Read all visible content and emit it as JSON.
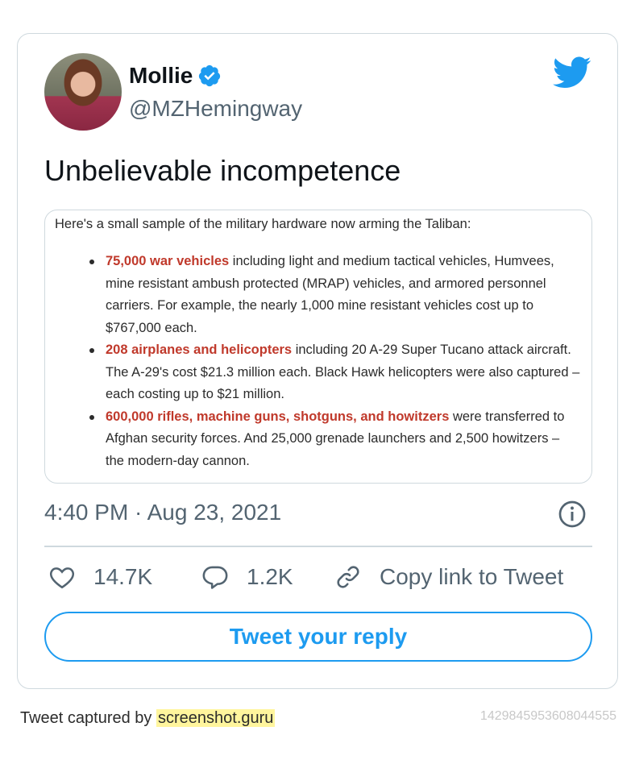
{
  "tweet": {
    "display_name": "Mollie",
    "handle": "@MZHemingway",
    "text": "Unbelievable incompetence",
    "timestamp": "4:40 PM · Aug 23, 2021",
    "media": {
      "intro": "Here's a small sample of the military hardware now arming the Taliban:",
      "items": [
        {
          "highlight": "75,000 war vehicles",
          "rest": " including light and medium tactical vehicles, Humvees, mine resistant ambush protected (MRAP) vehicles, and armored personnel carriers. For example, the nearly 1,000 mine resistant vehicles cost up to $767,000 each."
        },
        {
          "highlight": "208 airplanes and helicopters",
          "rest": " including 20 A-29 Super Tucano attack aircraft. The A-29's cost $21.3 million each. Black Hawk helicopters were also captured – each costing up to $21 million."
        },
        {
          "highlight": "600,000 rifles, machine guns, shotguns, and howitzers",
          "rest": " were transferred to Afghan security forces. And 25,000 grenade launchers and 2,500 howitzers – the modern-day cannon."
        }
      ]
    },
    "actions": {
      "likes": "14.7K",
      "replies": "1.2K",
      "copy_link": "Copy link to Tweet"
    },
    "reply_button": "Tweet your reply"
  },
  "footer": {
    "captured_prefix": "Tweet captured by ",
    "captured_link": "screenshot.guru",
    "tweet_id": "1429845953608044555"
  },
  "colors": {
    "accent": "#1d9bf0",
    "highlight_red": "#c0392b",
    "muted": "#536471"
  },
  "icons": [
    "verified-badge-icon",
    "twitter-bird-icon",
    "info-icon",
    "heart-icon",
    "reply-bubble-icon",
    "link-icon"
  ]
}
